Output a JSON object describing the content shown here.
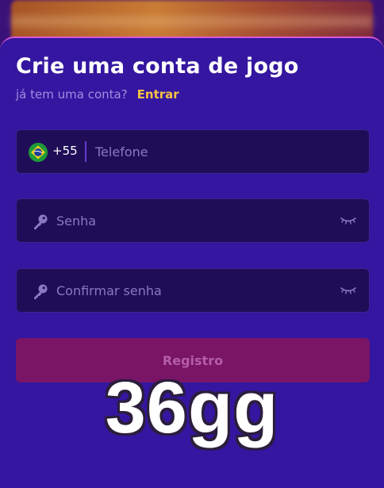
{
  "modal": {
    "title": "Crie uma conta de jogo",
    "subtitle": "já tem uma conta?",
    "login_link": "Entrar"
  },
  "phone": {
    "country_code": "+55",
    "placeholder": "Telefone",
    "flag_icon": "brazil-flag-icon"
  },
  "password": {
    "placeholder": "Senha",
    "icon": "key-icon",
    "toggle_icon": "eye-closed-icon"
  },
  "confirm_password": {
    "placeholder": "Confirmar senha",
    "icon": "key-icon",
    "toggle_icon": "eye-closed-icon"
  },
  "register_button": {
    "label": "Registro"
  },
  "watermark": {
    "text": "36gg"
  },
  "colors": {
    "modal_background": "#3416a0",
    "field_background": "#1f0e57",
    "accent_link": "#f7c244",
    "button_background": "#7a1466",
    "button_text": "#b45ea6",
    "modal_border": "#d85ad6"
  }
}
